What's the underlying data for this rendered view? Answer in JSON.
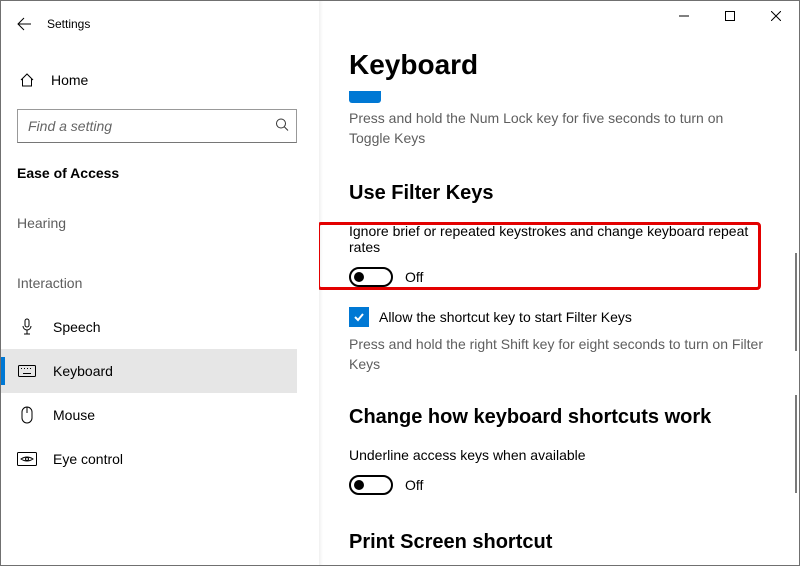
{
  "app": {
    "title": "Settings"
  },
  "sidebar": {
    "home_label": "Home",
    "search_placeholder": "Find a setting",
    "section_heading": "Ease of Access",
    "groups": {
      "hearing": "Hearing",
      "interaction": "Interaction"
    },
    "items": {
      "speech": "Speech",
      "keyboard": "Keyboard",
      "mouse": "Mouse",
      "eye_control": "Eye control"
    }
  },
  "content": {
    "page_title": "Keyboard",
    "prev_help": "Press and hold the Num Lock key for five seconds to turn on Toggle Keys",
    "filter_keys": {
      "heading": "Use Filter Keys",
      "description": "Ignore brief or repeated keystrokes and change keyboard repeat rates",
      "toggle_state": "Off",
      "shortcut_checkbox_label": "Allow the shortcut key to start Filter Keys",
      "shortcut_help": "Press and hold the right Shift key for eight seconds to turn on Filter Keys"
    },
    "shortcuts": {
      "heading": "Change how keyboard shortcuts work",
      "underline_label": "Underline access keys when available",
      "underline_state": "Off"
    },
    "print_screen": {
      "heading": "Print Screen shortcut"
    }
  }
}
